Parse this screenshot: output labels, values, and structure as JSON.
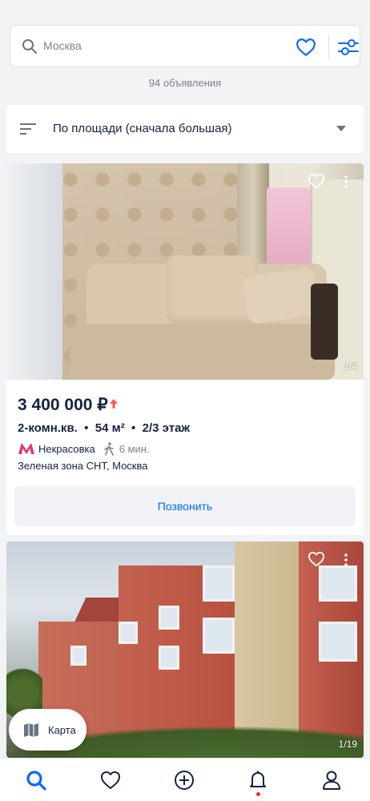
{
  "search": {
    "placeholder": "Москва",
    "icons": [
      "search-icon",
      "heart-icon",
      "filters-icon"
    ]
  },
  "results_count": "94 объявления",
  "sort": {
    "label": "По площади (сначала большая)"
  },
  "listings": [
    {
      "price": "3 400 000 ₽",
      "price_trend": "up",
      "params": "2-комн.кв.  •  54 м²  •  2/3 этаж",
      "metro_station": "Некрасовка",
      "walk_time": "6 мин.",
      "address": "Зеленая зона СНТ, Москва",
      "photo_counter": "1/4",
      "call_label": "Позвонить"
    },
    {
      "photo_counter": "1/19"
    }
  ],
  "map_button": {
    "label": "Карта"
  },
  "tabbar": [
    "search-icon",
    "heart-icon",
    "plus-icon",
    "bell-icon",
    "profile-icon"
  ],
  "colors": {
    "accent": "#0468ff",
    "text": "#152242",
    "muted": "#7a8294",
    "metro": "#e6336b",
    "trend_up": "#ff4f61"
  }
}
